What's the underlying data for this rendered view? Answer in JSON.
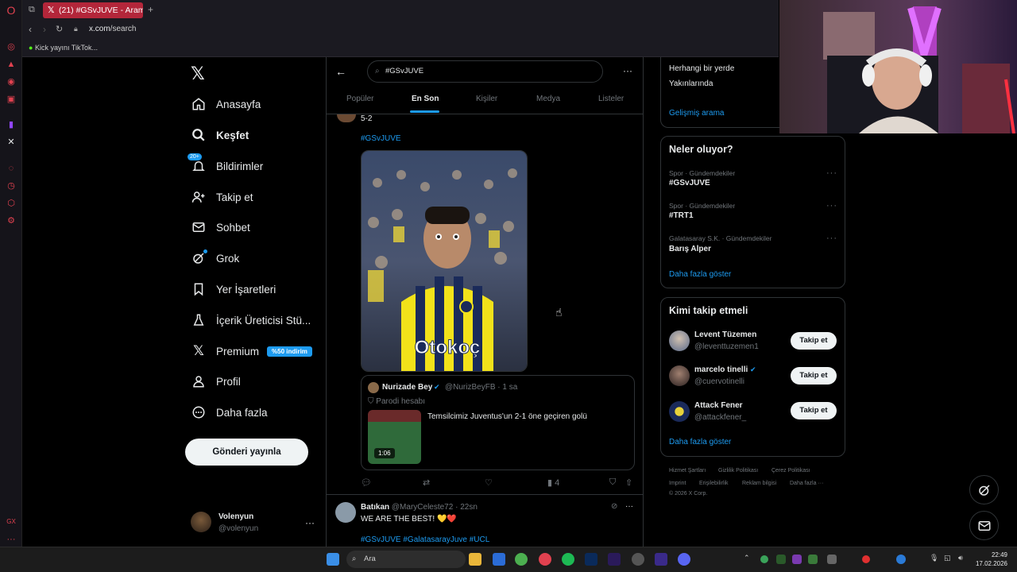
{
  "browser": {
    "tab_title": "(21) #GSvJUVE - Arama / X",
    "url": "x.com/search",
    "bookmark": "Kick yayını TikTok..."
  },
  "nav": {
    "items": [
      {
        "label": "Anasayfa",
        "icon": "home-icon"
      },
      {
        "label": "Keşfet",
        "icon": "search-icon"
      },
      {
        "label": "Bildirimler",
        "icon": "bell-icon",
        "badge": "20+"
      },
      {
        "label": "Takip et",
        "icon": "follow-icon"
      },
      {
        "label": "Sohbet",
        "icon": "mail-icon"
      },
      {
        "label": "Grok",
        "icon": "grok-icon"
      },
      {
        "label": "Yer İşaretleri",
        "icon": "bookmark-icon"
      },
      {
        "label": "İçerik Üreticisi Stü...",
        "icon": "creator-icon"
      },
      {
        "label": "Premium",
        "icon": "x-logo-icon",
        "badge": "%50 indirim"
      },
      {
        "label": "Profil",
        "icon": "profile-icon"
      },
      {
        "label": "Daha fazla",
        "icon": "more-icon"
      }
    ],
    "post_button": "Gönderi yayınla",
    "account": {
      "name": "Volenyun",
      "handle": "@volenyun"
    }
  },
  "search": {
    "query": "#GSvJUVE",
    "tabs": [
      "Popüler",
      "En Son",
      "Kişiler",
      "Medya",
      "Listeler"
    ],
    "active_tab": "En Son"
  },
  "tweet1": {
    "text_top": "5-2",
    "hashtag": "#GSvJUVE",
    "image_caption": "Otokoç",
    "quote": {
      "name": "Nurizade Bey",
      "handle": "@NurizBeyFB",
      "time": "1 sa",
      "label": "Parodi hesabı",
      "text": "Temsilcimiz Juventus'un 2-1 öne geçiren golü",
      "duration": "1:06"
    },
    "views": "4"
  },
  "tweet2": {
    "name": "Batıkan",
    "handle": "@MaryCeleste72",
    "time": "22sn",
    "text": "WE ARE THE BEST! 💛❤️",
    "tags": "#GSvJUVE #GalatasarayJuve #UCL"
  },
  "right": {
    "search_opts": [
      "Herhangi bir yerde",
      "Yakınlarında"
    ],
    "advanced": "Gelişmiş arama",
    "trends_title": "Neler oluyor?",
    "trends": [
      {
        "meta": "Spor · Gündemdekiler",
        "name": "#GSvJUVE"
      },
      {
        "meta": "Spor · Gündemdekiler",
        "name": "#TRT1"
      },
      {
        "meta": "Galatasaray S.K. · Gündemdekiler",
        "name": "Barış Alper"
      }
    ],
    "show_more": "Daha fazla göster",
    "wtf_title": "Kimi takip etmeli",
    "follows": [
      {
        "name": "Levent Tüzemen",
        "handle": "@leventtuzemen1",
        "verified": false
      },
      {
        "name": "marcelo tinelli",
        "handle": "@cuervotinelli",
        "verified": true
      },
      {
        "name": "Attack Fener",
        "handle": "@attackfener_",
        "verified": false
      }
    ],
    "follow_label": "Takip et",
    "footer": [
      "Hizmet Şartları",
      "Gizlilik Politikası",
      "Çerez Politikası",
      "Imprint",
      "Erişilebilirlik",
      "Reklam bilgisi",
      "Daha fazla ···",
      "© 2026 X Corp."
    ]
  },
  "taskbar": {
    "search": "Ara",
    "time": "22:49",
    "date": "17.02.2026"
  }
}
